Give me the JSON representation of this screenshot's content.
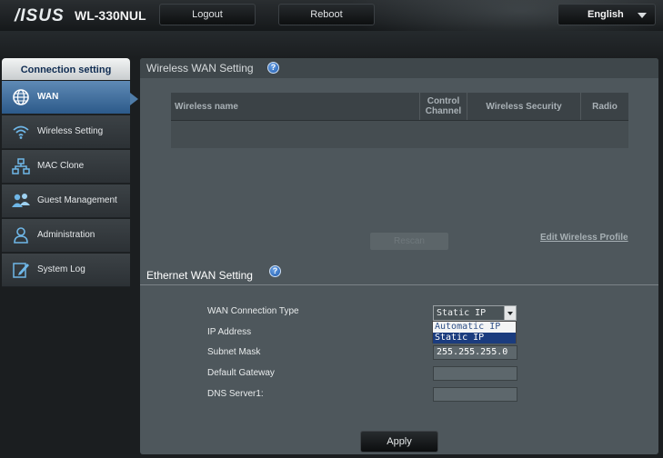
{
  "header": {
    "brand": "/ISUS",
    "model": "WL-330NUL",
    "logout_label": "Logout",
    "reboot_label": "Reboot",
    "language": "English"
  },
  "sidebar": {
    "title": "Connection setting",
    "items": [
      {
        "label": "WAN",
        "icon": "globe-icon",
        "active": true
      },
      {
        "label": "Wireless Setting",
        "icon": "wifi-icon",
        "active": false
      },
      {
        "label": "MAC Clone",
        "icon": "network-icon",
        "active": false
      },
      {
        "label": "Guest Management",
        "icon": "guest-users-icon",
        "active": false
      },
      {
        "label": "Administration",
        "icon": "admin-user-icon",
        "active": false
      },
      {
        "label": "System Log",
        "icon": "log-edit-icon",
        "active": false
      }
    ]
  },
  "wireless_wan": {
    "title": "Wireless WAN Setting",
    "columns": [
      "Wireless name",
      "Control Channel",
      "Wireless Security",
      "Radio"
    ],
    "rescan_label": "Rescan",
    "edit_profile_label": "Edit Wireless Profile"
  },
  "ethernet_wan": {
    "title": "Ethernet WAN Setting",
    "connection_type_label": "WAN Connection Type",
    "connection_type_value": "Static IP",
    "connection_type_options": [
      "Automatic IP",
      "Static IP"
    ],
    "ip_address_label": "IP Address",
    "subnet_mask_label": "Subnet Mask",
    "subnet_mask_value": "255.255.255.0",
    "gateway_label": "Default Gateway",
    "dns1_label": "DNS Server1:"
  },
  "apply_label": "Apply",
  "colors": {
    "active_nav": "#3f6f9f",
    "panel_bg": "#4e575c",
    "help_icon": "#2f6fc0"
  }
}
